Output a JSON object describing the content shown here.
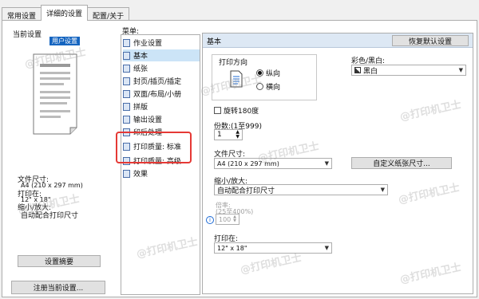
{
  "tabs": [
    {
      "label": "常用设置"
    },
    {
      "label": "详细的设置"
    },
    {
      "label": "配置/关于"
    }
  ],
  "left": {
    "current_settings_label": "当前设置",
    "preview_tag": "用户设置",
    "paper_size_label": "文件尺寸:",
    "paper_size_value": "A4 (210 x 297 mm)",
    "print_on_label": "打印在:",
    "print_on_value": "12\" x 18\"",
    "scale_label": "缩小/放大:",
    "scale_value": "自动配合打印尺寸",
    "summary_button": "设置摘要",
    "register_button": "注册当前设置..."
  },
  "menu": {
    "label": "菜单:",
    "items": [
      {
        "label": "作业设置"
      },
      {
        "label": "基本"
      },
      {
        "label": "纸张"
      },
      {
        "label": "封页/插页/插定"
      },
      {
        "label": "双面/布局/小册"
      },
      {
        "label": "拼版"
      },
      {
        "label": "输出设置"
      },
      {
        "label": "印后处理"
      },
      {
        "label": "打印质量: 标准"
      },
      {
        "label": "打印质量: 高级"
      },
      {
        "label": "效果"
      }
    ]
  },
  "basic": {
    "header": "基本",
    "reset_button": "恢复默认设置",
    "orientation_label": "打印方向",
    "portrait_label": "纵向",
    "landscape_label": "横向",
    "color_label": "彩色/黑白:",
    "color_value": "黑白",
    "rotate_label": "旋转180度",
    "copies_label": "份数:(1至999)",
    "copies_value": "1",
    "doc_size_label": "文件尺寸:",
    "doc_size_value": "A4 (210 x 297 mm)",
    "custom_size_button": "自定义纸张尺寸...",
    "scale_label": "缩小/放大:",
    "scale_value": "自动配合打印尺寸",
    "percent_label": "倍率:",
    "percent_range": "(25至400%)",
    "percent_value": "100",
    "print_on_label": "打印在:",
    "print_on_value": "12\" x 18\""
  },
  "watermark": "@打印机卫士"
}
